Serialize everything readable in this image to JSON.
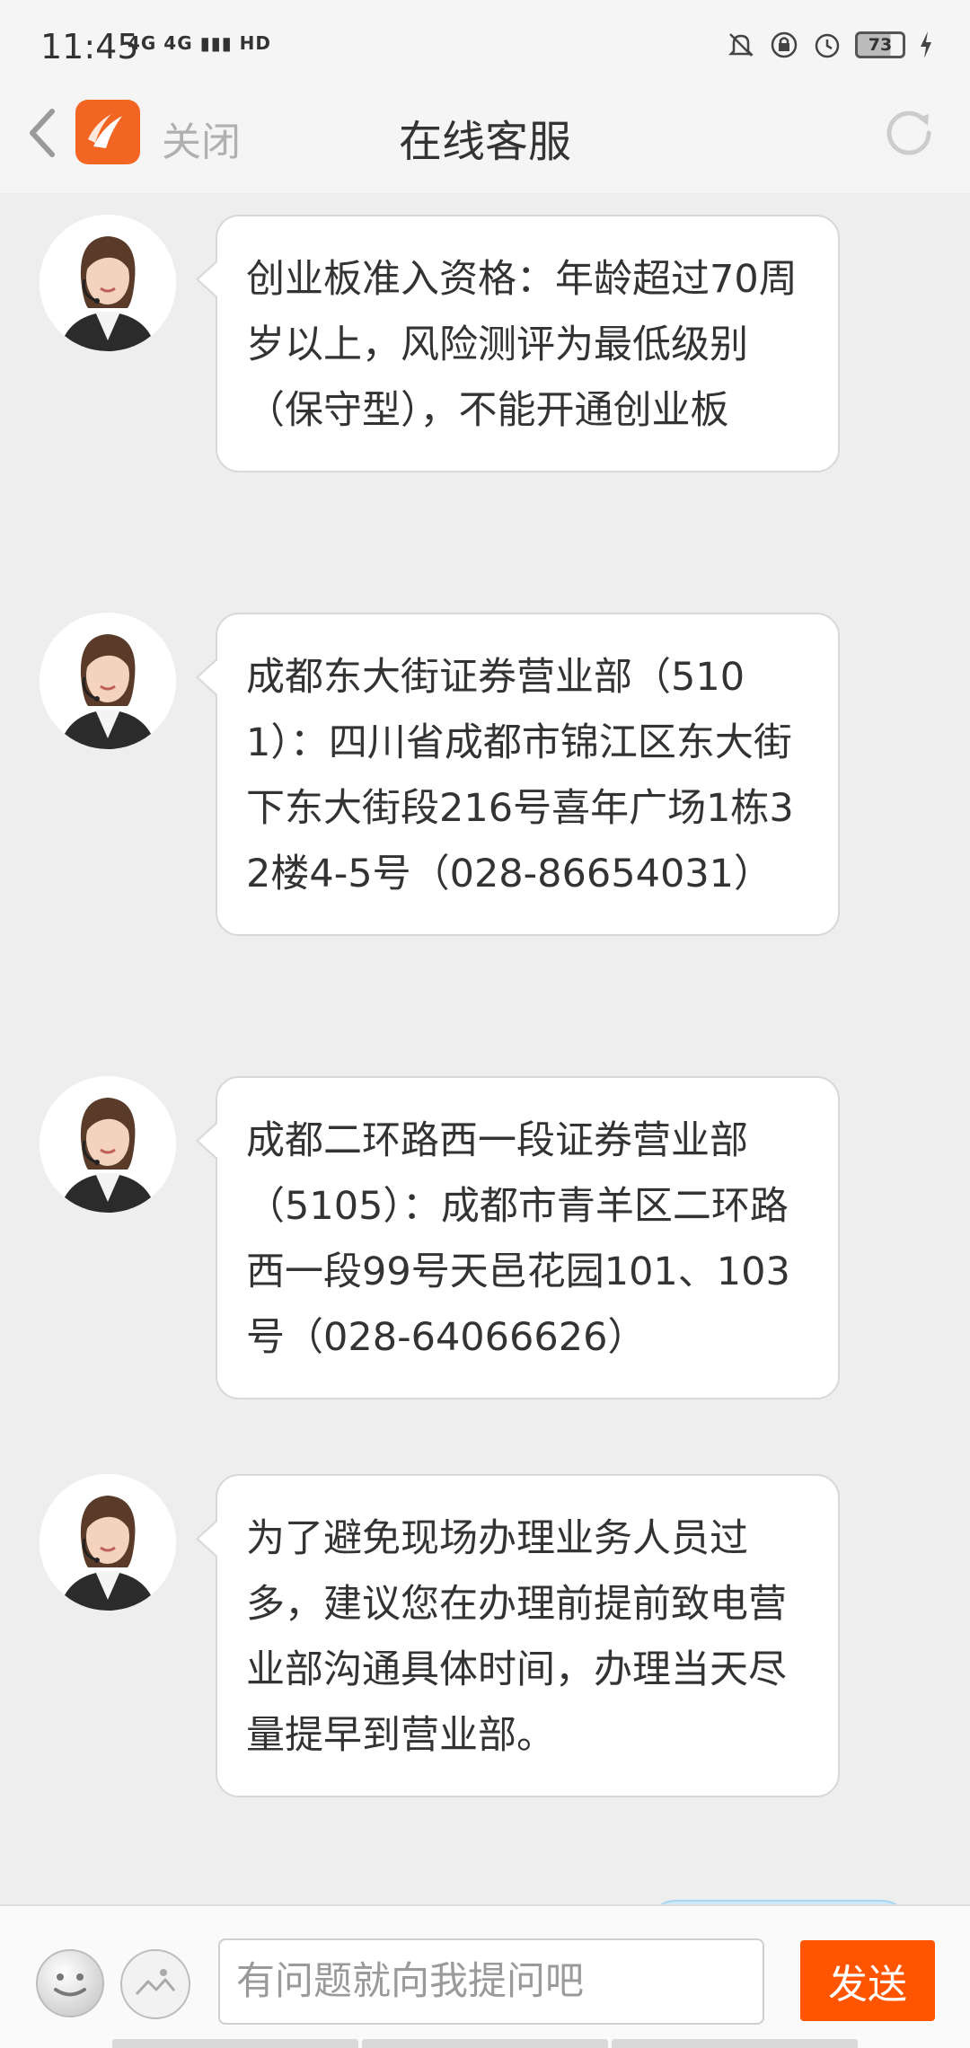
{
  "status_bar": {
    "time": "11:45",
    "network": "4G 4G",
    "hd": "HD",
    "battery": "73"
  },
  "header": {
    "close_label": "关闭",
    "title": "在线客服"
  },
  "messages": [
    {
      "text": "创业板准入资格：年龄超过70周岁以上，风险测评为最低级别（保守型），不能开通创业板"
    },
    {
      "text": "成都东大街证券营业部（5101）：四川省成都市锦江区东大街下东大街段216号喜年广场1栋32楼4-5号（028-86654031）"
    },
    {
      "text": "成都二环路西一段证券营业部（5105）：成都市青羊区二环路西一段99号天邑花园101、103号（028-64066626）"
    },
    {
      "text": "为了避免现场办理业务人员过多，建议您在办理前提前致电营业部沟通具体时间，办理当天尽量提早到营业部。"
    }
  ],
  "input_bar": {
    "placeholder": "有问题就向我提问吧",
    "send_label": "发送"
  },
  "colors": {
    "accent": "#ff5500",
    "logo": "#f26522",
    "background": "#eeeeee"
  }
}
